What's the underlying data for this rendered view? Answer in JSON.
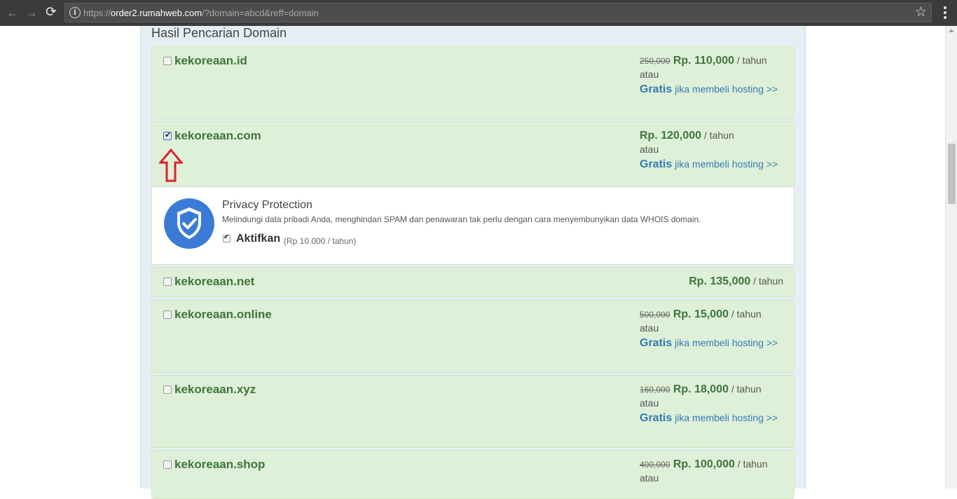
{
  "browser": {
    "url_prefix": "https://",
    "url_host": "order2.rumahweb.com",
    "url_path": "/?domain=abcd&reff=domain",
    "nav_back_icon": "arrow-left-icon",
    "nav_forward_icon": "arrow-right-icon",
    "reload_icon": "reload-icon",
    "bookmark_icon": "star-icon"
  },
  "panel": {
    "title": "Hasil Pencarian Domain"
  },
  "domains": [
    {
      "name": "kekoreaan.id",
      "checked": false,
      "old_price": "250,000",
      "price": "Rp. 110,000",
      "per": " / tahun",
      "atau": "atau",
      "gratis": "Gratis",
      "gratis_link": " jika membeli hosting >>"
    },
    {
      "name": "kekoreaan.com",
      "checked": true,
      "old_price": "",
      "price": "Rp. 120,000",
      "per": " / tahun",
      "atau": "atau",
      "gratis": "Gratis",
      "gratis_link": " jika membeli hosting >>"
    },
    {
      "name": "kekoreaan.net",
      "checked": false,
      "price": "Rp. 135,000",
      "per": " / tahun"
    },
    {
      "name": "kekoreaan.online",
      "checked": false,
      "old_price": "500,000",
      "price": "Rp. 15,000",
      "per": " / tahun",
      "atau": "atau",
      "gratis": "Gratis",
      "gratis_link": " jika membeli hosting >>"
    },
    {
      "name": "kekoreaan.xyz",
      "checked": false,
      "old_price": "160,000",
      "price": "Rp. 18,000",
      "per": " / tahun",
      "atau": "atau",
      "gratis": "Gratis",
      "gratis_link": " jika membeli hosting >>"
    },
    {
      "name": "kekoreaan.shop",
      "checked": false,
      "old_price": "400,000",
      "price": "Rp. 100,000",
      "per": " / tahun",
      "atau": "atau"
    }
  ],
  "privacy": {
    "title": "Privacy Protection",
    "description": "Melindungi data pribadi Anda, menghindari SPAM dan penawaran tak perlu dengan cara menyembunyikan data WHOIS domain.",
    "enable_label": "Aktifkan",
    "enable_price": "(Rp 10.000 / tahun)",
    "enabled": true,
    "shield_color": "#3a7bd5"
  },
  "colors": {
    "row_bg": "#dff0d8",
    "price_green": "#3c763d",
    "link_blue": "#337ab7",
    "annotation_red": "#d9232a"
  }
}
